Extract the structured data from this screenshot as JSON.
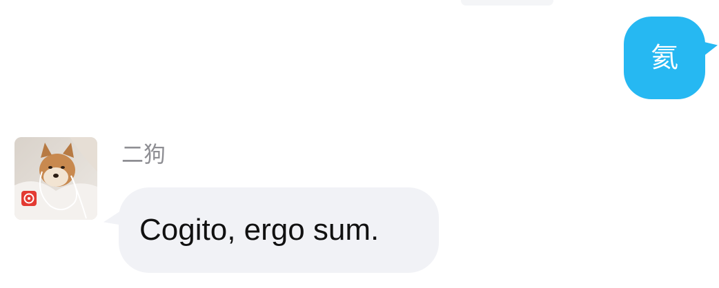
{
  "conversation": {
    "outgoing": {
      "text": "氦",
      "bubble_color": "#26b8f2"
    },
    "incoming": {
      "sender_name": "二狗",
      "text": "Cogito, ergo sum.",
      "bubble_color": "#f1f2f6",
      "avatar_icon": "shiba-dog-avatar",
      "badge_icon": "music-app-badge-icon"
    }
  }
}
